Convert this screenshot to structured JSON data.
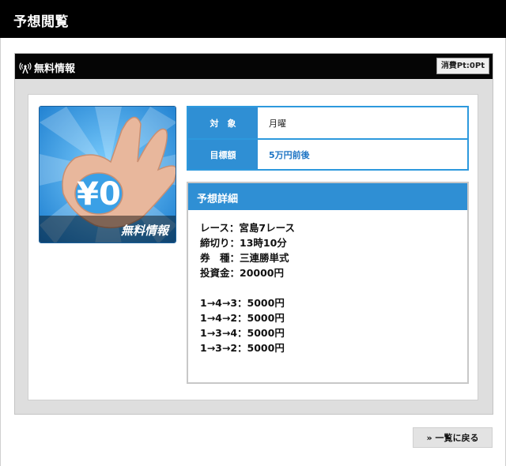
{
  "header": {
    "title": "予想閲覧"
  },
  "panel": {
    "title": "無料情報",
    "points_badge": "消費Pt:0Pt"
  },
  "banner": {
    "price_text": "¥0",
    "caption": "無料情報"
  },
  "info": {
    "rows": [
      {
        "label": "対　象",
        "value": "月曜"
      },
      {
        "label": "目標額",
        "value": "5万円前後"
      }
    ]
  },
  "detail": {
    "title": "予想詳細",
    "lines": [
      "レース：宮島7レース",
      "締切り：13時10分",
      "券　種：三連勝単式",
      "投資金：20000円"
    ],
    "bets": [
      "1→4→3：5000円",
      "1→4→2：5000円",
      "1→3→4：5000円",
      "1→3→2：5000円"
    ]
  },
  "footer": {
    "back_label": "一覧に戻る"
  },
  "colors": {
    "accent_blue": "#2f8fd4",
    "border_blue": "#2d99dd",
    "header_black": "#000000",
    "panel_gray": "#dedede"
  }
}
